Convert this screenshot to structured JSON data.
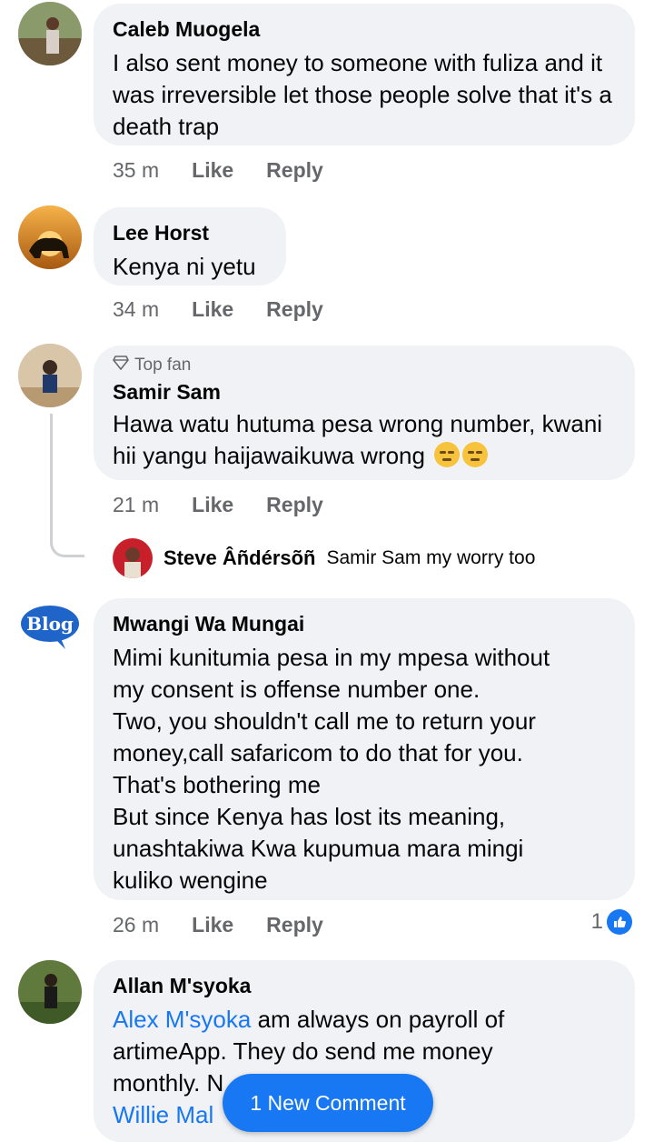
{
  "comments": [
    {
      "author": "Caleb Muogela",
      "text": "I also sent money to someone with fuliza and it was irreversible let those people solve that it's a death trap",
      "time": "35 m"
    },
    {
      "author": "Lee Horst",
      "text": "Kenya ni yetu",
      "time": "34 m"
    },
    {
      "badge": "Top fan",
      "author": "Samir Sam",
      "text": "Hawa watu hutuma pesa wrong number, kwani hii yangu haijawaikuwa wrong",
      "time": "21 m"
    },
    {
      "author": "Mwangi Wa Mungai",
      "lines": [
        "Mimi kunitumia pesa in my mpesa without",
        "my consent is offense number one.",
        "Two, you shouldn't call me to return your",
        "money,call safaricom to do that for you.",
        "That's bothering me",
        "But since Kenya has lost its meaning,",
        "unashtakiwa Kwa kupumua mara mingi",
        "kuliko wengine"
      ],
      "time": "26 m",
      "reactions": "1"
    },
    {
      "author": "Allan M'syoka",
      "mention": "Alex M'syoka",
      "text_after_mention": " am always on payroll of",
      "line2": "artimeApp. They do send me money",
      "line3": "monthly. N",
      "mention2": "Willie Mal"
    }
  ],
  "reply_preview": {
    "author": "Steve Âñdérsõñ",
    "text": "Samir Sam my worry too"
  },
  "actions": {
    "like": "Like",
    "reply": "Reply"
  },
  "new_comment_button": "1 New Comment",
  "colors": {
    "accent": "#1877f2",
    "bubble": "#f0f2f5",
    "meta": "#65676b"
  },
  "avatar_labels": {
    "blog": "Blog"
  }
}
